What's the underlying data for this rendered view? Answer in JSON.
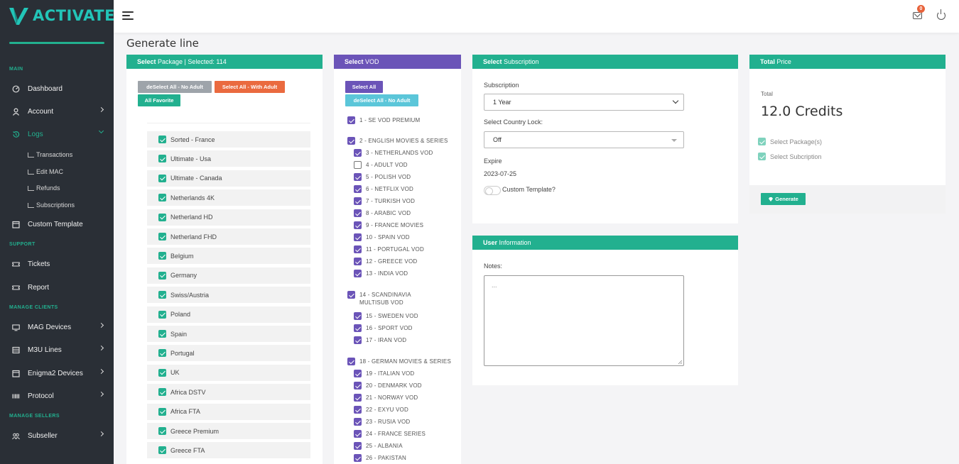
{
  "brand": {
    "name": "ACTIVATE",
    "accent": "#22b08f",
    "sidebar_bg": "#2a2f36"
  },
  "topbar": {
    "mail_badge": "0"
  },
  "sidebar": {
    "sections": {
      "main": "MAIN",
      "support": "SUPPORT",
      "manage_clients": "MANAGE CLIENTS",
      "manage_sellers": "MANAGE SELLERS"
    },
    "items": {
      "dashboard": "Dashboard",
      "account": "Account",
      "logs": "Logs",
      "custom_template": "Custom Template",
      "tickets": "Tickets",
      "report": "Report",
      "mag_devices": "MAG Devices",
      "m3u_lines": "M3U Lines",
      "enigma2_devices": "Enigma2 Devices",
      "protocol": "Protocol",
      "subseller": "Subseller"
    },
    "logs_sub": [
      "Transactions",
      "Edit MAC",
      "Refunds",
      "Subscriptions"
    ]
  },
  "page": {
    "title": "Generate line"
  },
  "package_card": {
    "head_bold": "Select",
    "head_rest": " Package | Selected: 114",
    "btn_deselect": "deSelect All - No Adult",
    "btn_select_adult": "Select All - With Adult",
    "btn_favorite": "All Favorite",
    "packages": [
      "Sorted - France",
      "Ultimate - Usa",
      "Ultimate - Canada",
      "Netherlands 4K",
      "Netherland HD",
      "Netherland FHD",
      "Belgium",
      "Germany",
      "Swiss/Austria",
      "Poland",
      "Spain",
      "Portugal",
      "UK",
      "Africa DSTV",
      "Africa FTA",
      "Greece Premium",
      "Greece FTA"
    ]
  },
  "vod_card": {
    "head_bold": "Select",
    "head_rest": " VOD",
    "btn_select_all": "Select All",
    "btn_deselect": "deSelect All - No Adult",
    "items": [
      {
        "label": "1 - SE VOD PREMIUM",
        "checked": true
      },
      {
        "label": "2 - ENGLISH MOVIES & SERIES",
        "checked": true
      },
      {
        "label": "3 - NETHERLANDS VOD",
        "checked": true
      },
      {
        "label": "4 - ADULT VOD",
        "checked": false
      },
      {
        "label": "5 - POLISH VOD",
        "checked": true
      },
      {
        "label": "6 - NETFLIX VOD",
        "checked": true
      },
      {
        "label": "7 - TURKISH VOD",
        "checked": true
      },
      {
        "label": "8 - ARABIC VOD",
        "checked": true
      },
      {
        "label": "9 - FRANCE MOVIES",
        "checked": true
      },
      {
        "label": "10 - SPAIN VOD",
        "checked": true
      },
      {
        "label": "11 - PORTUGAL VOD",
        "checked": true
      },
      {
        "label": "12 - GREECE VOD",
        "checked": true
      },
      {
        "label": "13 - INDIA VOD",
        "checked": true
      },
      {
        "label": "14 - SCANDINAVIA MULTISUB VOD",
        "checked": true
      },
      {
        "label": "15 - SWEDEN VOD",
        "checked": true
      },
      {
        "label": "16 - SPORT VOD",
        "checked": true
      },
      {
        "label": "17 - IRAN VOD",
        "checked": true
      },
      {
        "label": "18 - GERMAN MOVIES & SERIES",
        "checked": true
      },
      {
        "label": "19 - ITALIAN VOD",
        "checked": true
      },
      {
        "label": "20 - DENMARK VOD",
        "checked": true
      },
      {
        "label": "21 - NORWAY VOD",
        "checked": true
      },
      {
        "label": "22 - EXYU VOD",
        "checked": true
      },
      {
        "label": "23 - RUSIA VOD",
        "checked": true
      },
      {
        "label": "24 - FRANCE SERIES",
        "checked": true
      },
      {
        "label": "25 - ALBANIA",
        "checked": true
      },
      {
        "label": "26 - PAKISTAN",
        "checked": true
      }
    ]
  },
  "subscription_card": {
    "head_bold": "Select",
    "head_rest": " Subscription",
    "subscription_label": "Subscription",
    "subscription_value": "1 Year",
    "country_label": "Select Country Lock:",
    "country_value": "Off",
    "expire_label": "Expire",
    "expire_value": "2023-07-25",
    "custom_template_label": "Custom Template?"
  },
  "user_card": {
    "head_bold": "User",
    "head_rest": " Information",
    "notes_label": "Notes:",
    "notes_value": "..."
  },
  "total_card": {
    "head_bold": "Total",
    "head_rest": " Price",
    "total_label": "Total",
    "total_value": "12.0 Credits",
    "check_packages": "Select Package(s)",
    "check_subscription": "Select Subcription",
    "generate_label": "Generate"
  }
}
